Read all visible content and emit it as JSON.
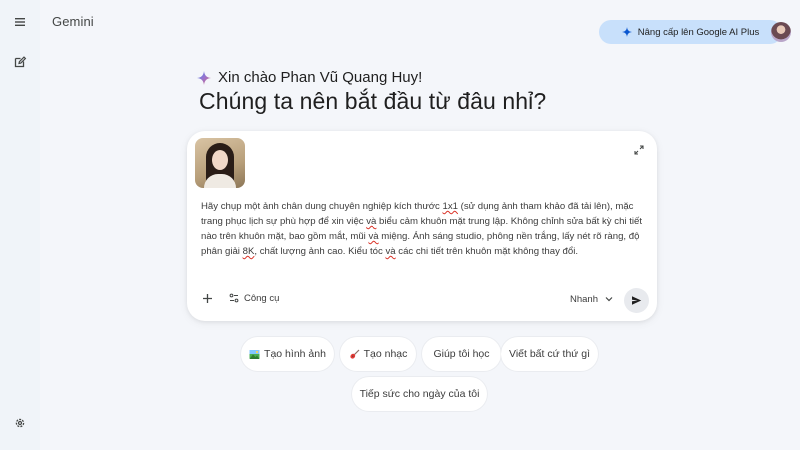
{
  "app": {
    "brand": "Gemini",
    "upgrade_label": "Nâng cấp lên Google AI Plus"
  },
  "greeting": {
    "hello": "Xin chào Phan Vũ Quang Huy!",
    "headline": "Chúng ta nên bắt đầu từ đâu nhỉ?"
  },
  "prompt": {
    "segments": [
      {
        "text": "Hãy chụp một ảnh chân dung chuyên nghiệp kích thước ",
        "underline": false
      },
      {
        "text": "1x1",
        "underline": true
      },
      {
        "text": " (sử dụng ảnh tham khảo đã tải lên), mặc trang phục lịch sự phù hợp để xin việc ",
        "underline": false
      },
      {
        "text": "và",
        "underline": true
      },
      {
        "text": " biểu cảm khuôn mặt trung lập. Không chỉnh sửa bất kỳ chi tiết nào trên khuôn mặt, bao gồm mắt, mũi ",
        "underline": false
      },
      {
        "text": "và",
        "underline": true
      },
      {
        "text": " miệng. Ánh sáng studio, phông nền trắng, lấy nét rõ ràng, độ phân giải ",
        "underline": false
      },
      {
        "text": "8K",
        "underline": true
      },
      {
        "text": ", chất lượng ảnh cao. Kiểu tóc ",
        "underline": false
      },
      {
        "text": "và",
        "underline": true
      },
      {
        "text": " các chi tiết trên khuôn mặt không thay đổi.",
        "underline": false
      }
    ],
    "tools_label": "Công cụ",
    "model_label": "Nhanh"
  },
  "chips": [
    {
      "label": "Tạo hình ảnh",
      "icon": "image-icon"
    },
    {
      "label": "Tạo nhạc",
      "icon": "guitar-icon"
    },
    {
      "label": "Giúp tôi học",
      "icon": ""
    },
    {
      "label": "Viết bất cứ thứ gì",
      "icon": ""
    },
    {
      "label": "Tiếp sức cho ngày của tôi",
      "icon": ""
    }
  ],
  "colors": {
    "background": "#f0f4f9",
    "upgrade_bg": "#c8e0fb",
    "card_bg": "#ffffff",
    "accent_blue": "#1a73e8"
  }
}
